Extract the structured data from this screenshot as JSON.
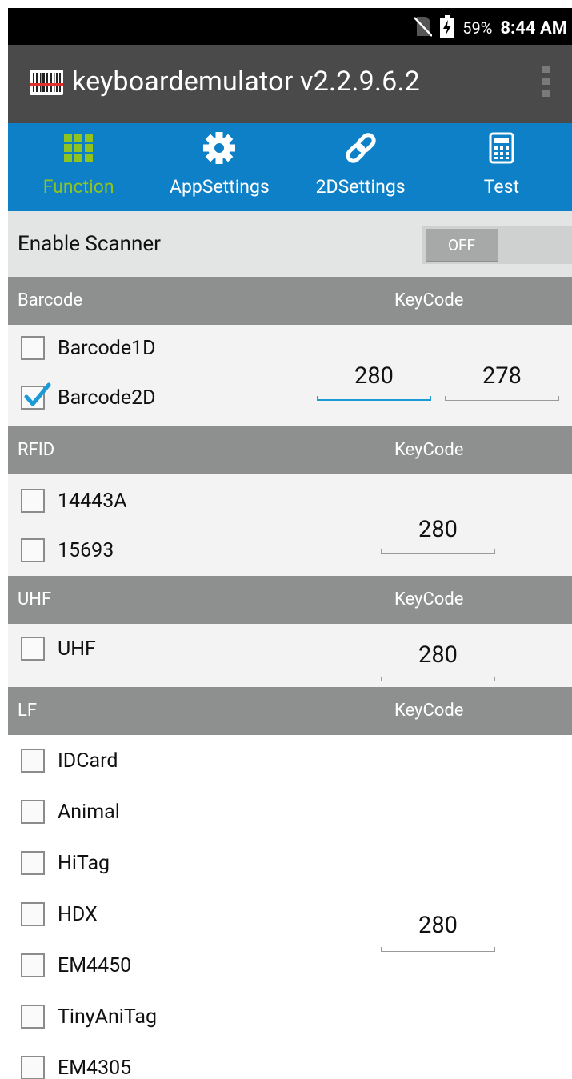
{
  "status_bar": {
    "battery_percent": "59%",
    "time": "8:44 AM"
  },
  "app": {
    "title": "keyboardemulator v2.2.9.6.2"
  },
  "tabs": [
    {
      "label": "Function",
      "icon": "grid-icon",
      "active": true
    },
    {
      "label": "AppSettings",
      "icon": "gear-icon",
      "active": false
    },
    {
      "label": "2DSettings",
      "icon": "link-icon",
      "active": false
    },
    {
      "label": "Test",
      "icon": "calculator-icon",
      "active": false
    }
  ],
  "enable_scanner": {
    "label": "Enable Scanner",
    "switch_text": "OFF",
    "enabled": false
  },
  "sections": {
    "barcode": {
      "header": "Barcode",
      "keycode_header": "KeyCode",
      "items": [
        {
          "label": "Barcode1D",
          "checked": false
        },
        {
          "label": "Barcode2D",
          "checked": true
        }
      ],
      "keycodes": [
        "280",
        "278"
      ]
    },
    "rfid": {
      "header": "RFID",
      "keycode_header": "KeyCode",
      "items": [
        {
          "label": "14443A",
          "checked": false
        },
        {
          "label": "15693",
          "checked": false
        }
      ],
      "keycode": "280"
    },
    "uhf": {
      "header": "UHF",
      "keycode_header": "KeyCode",
      "items": [
        {
          "label": "UHF",
          "checked": false
        }
      ],
      "keycode": "280"
    },
    "lf": {
      "header": "LF",
      "keycode_header": "KeyCode",
      "items": [
        {
          "label": "IDCard",
          "checked": false
        },
        {
          "label": "Animal",
          "checked": false
        },
        {
          "label": "HiTag",
          "checked": false
        },
        {
          "label": "HDX",
          "checked": false
        },
        {
          "label": "EM4450",
          "checked": false
        },
        {
          "label": "TinyAniTag",
          "checked": false
        },
        {
          "label": "EM4305",
          "checked": false
        }
      ],
      "keycode": "280"
    }
  },
  "colors": {
    "tab_bar": "#0d80c7",
    "active_tab_text": "#8fc31f",
    "action_bar": "#4a4a4a",
    "section_header": "#8e9090",
    "focus_underline": "#1a9ad6",
    "checkmark": "#1a9ad6"
  }
}
